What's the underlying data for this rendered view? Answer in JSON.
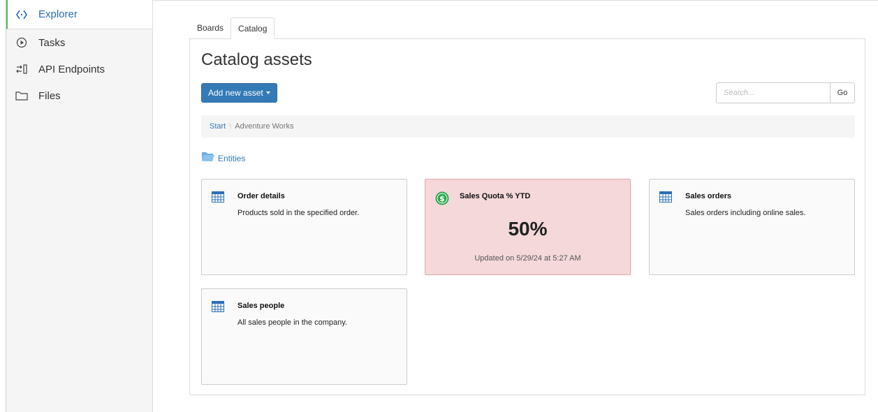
{
  "sidebar": {
    "items": [
      {
        "label": "Explorer",
        "icon": "explorer-icon",
        "active": true
      },
      {
        "label": "Tasks",
        "icon": "play-circle-icon",
        "active": false
      },
      {
        "label": "API Endpoints",
        "icon": "api-transfer-icon",
        "active": false
      },
      {
        "label": "Files",
        "icon": "folder-icon",
        "active": false
      }
    ]
  },
  "tabs": [
    {
      "label": "Boards",
      "active": false
    },
    {
      "label": "Catalog",
      "active": true
    }
  ],
  "main": {
    "title": "Catalog assets",
    "add_button_label": "Add new asset",
    "search": {
      "placeholder": "Search...",
      "value": "",
      "go_label": "Go"
    },
    "breadcrumb": {
      "start": "Start",
      "separator": "\\",
      "current": "Adventure Works"
    },
    "folder": {
      "label": "Entities",
      "icon": "folder-open-icon"
    },
    "cards": [
      {
        "title": "Order details",
        "description": "Products sold in the specified order.",
        "icon": "table-icon"
      },
      {
        "title": "Sales Quota % YTD",
        "value": "50%",
        "updated": "Updated on 5/29/24 at 5:27 AM",
        "icon": "dollar-coin-icon",
        "status_color": "#f4d8da"
      },
      {
        "title": "Sales orders",
        "description": "Sales orders including online sales.",
        "icon": "table-icon"
      },
      {
        "title": "Sales people",
        "description": "All sales people in the company.",
        "icon": "table-icon"
      }
    ]
  },
  "colors": {
    "accent": "#337ab7",
    "active_border": "#5cb85c",
    "kpi_alert": "#f4d8da",
    "kpi_icon": "#2fa84f"
  }
}
